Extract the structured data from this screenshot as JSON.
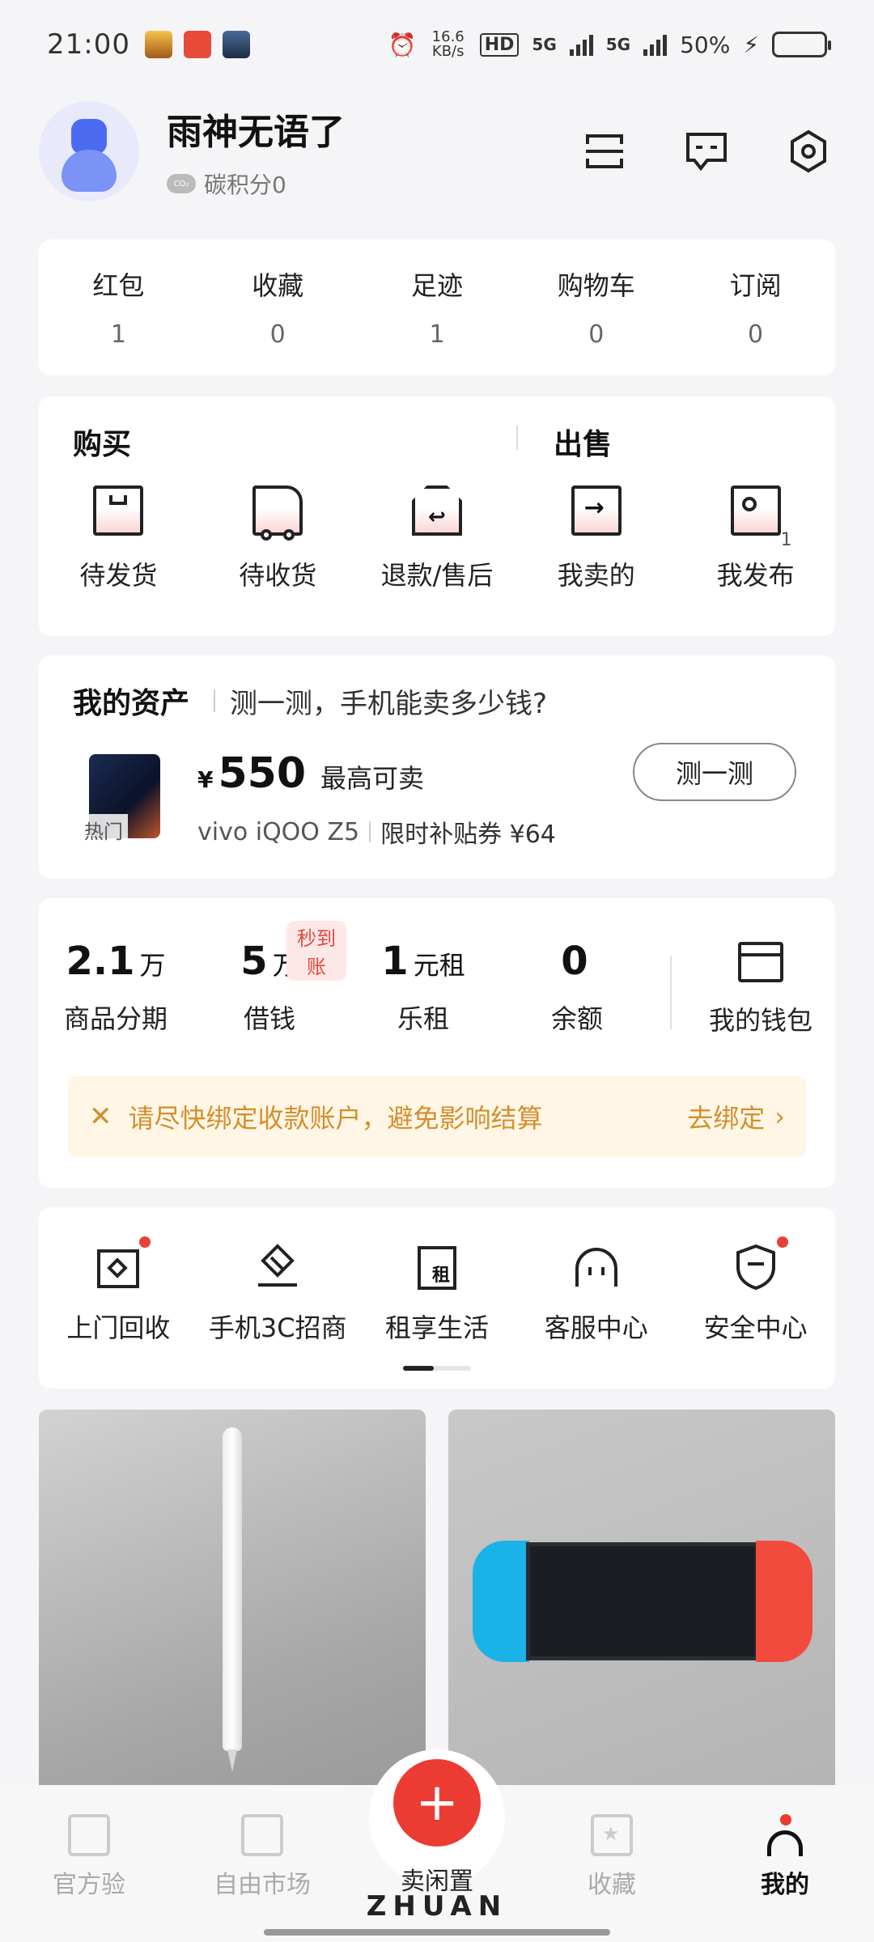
{
  "status_bar": {
    "time": "21:00",
    "net_speed": "16.6 KB/s",
    "hd": "HD",
    "net1": "5G",
    "net2": "5G",
    "battery": "50%",
    "battery_level": 0.5
  },
  "profile": {
    "name": "雨神无语了",
    "carbon": "碳积分0",
    "carbon_badge": "CO₂"
  },
  "stats": [
    {
      "label": "红包",
      "value": "1"
    },
    {
      "label": "收藏",
      "value": "0"
    },
    {
      "label": "足迹",
      "value": "1"
    },
    {
      "label": "购物车",
      "value": "0"
    },
    {
      "label": "订阅",
      "value": "0"
    }
  ],
  "trade": {
    "buy_title": "购买",
    "sell_title": "出售",
    "items": [
      {
        "label": "待发货",
        "icon": "box-icon"
      },
      {
        "label": "待收货",
        "icon": "truck-icon"
      },
      {
        "label": "退款/售后",
        "icon": "return-icon"
      },
      {
        "label": "我卖的",
        "icon": "sold-icon"
      },
      {
        "label": "我发布",
        "icon": "publish-icon",
        "count": "1"
      }
    ]
  },
  "assets": {
    "title": "我的资产",
    "subtitle": "测一测，手机能卖多少钱?",
    "hot_tag": "热门",
    "yen": "¥",
    "price": "550",
    "price_note": "最高可卖",
    "model": "vivo iQOO Z5",
    "subsidy": "限时补贴券 ¥64",
    "test_button": "测一测"
  },
  "finance": {
    "items": [
      {
        "value": "2.1",
        "unit": "万",
        "label": "商品分期"
      },
      {
        "value": "5",
        "unit": "万",
        "label": "借钱",
        "badge": "秒到账"
      },
      {
        "value": "1",
        "unit": "元租",
        "label": "乐租"
      },
      {
        "value": "0",
        "unit": "",
        "label": "余额"
      }
    ],
    "wallet_label": "我的钱包",
    "notice": "请尽快绑定收款账户，避免影响结算",
    "notice_action": "去绑定"
  },
  "tools": [
    {
      "label": "上门回收",
      "icon": "recycle-icon",
      "dot": true
    },
    {
      "label": "手机3C招商",
      "icon": "merchant-icon",
      "dot": false
    },
    {
      "label": "租享生活",
      "icon": "rent-icon",
      "dot": false,
      "glyph": "租"
    },
    {
      "label": "客服中心",
      "icon": "headset-icon",
      "dot": false
    },
    {
      "label": "安全中心",
      "icon": "shield-icon",
      "dot": true
    }
  ],
  "navbar": {
    "items": [
      "官方验",
      "自由市场",
      "收藏",
      "我的"
    ],
    "fab_label": "卖闲置",
    "fab_glyph": "+",
    "brand": "ZHUAN"
  },
  "colors": {
    "accent": "#ec3b33",
    "notice_text": "#d68e2c",
    "notice_bg": "#fff6e6"
  }
}
